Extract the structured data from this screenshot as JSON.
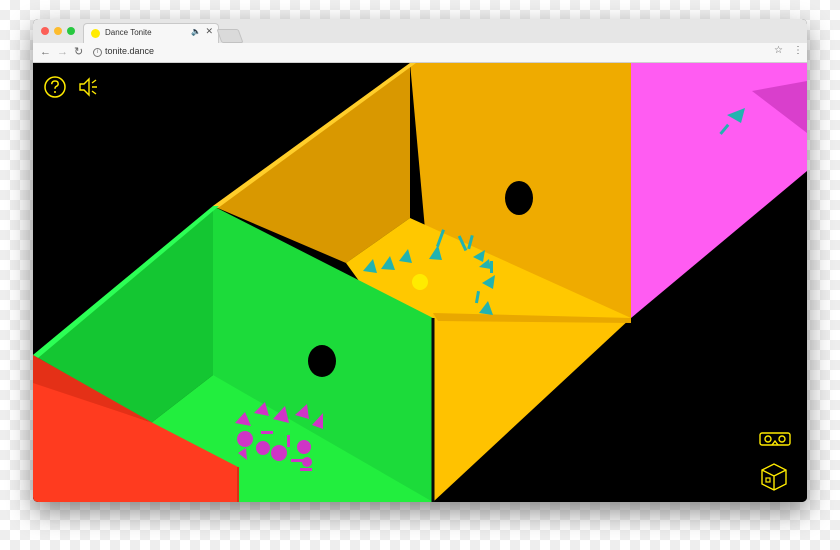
{
  "browser": {
    "tab_title": "Dance Tonite",
    "url": "tonite.dance",
    "info_glyph": "i",
    "tab_audio_glyph": "🔈",
    "tab_close_glyph": "✕",
    "back_glyph": "←",
    "forward_glyph": "→",
    "reload_glyph": "↻",
    "star_glyph": "☆",
    "menu_glyph": "⋮"
  },
  "icons": {
    "help": "help-icon",
    "audio": "audio-icon",
    "vr": "vr-headset-icon",
    "room": "room-cube-icon"
  },
  "colors": {
    "accent": "#ffeb00",
    "close_dot": "#fc5f57",
    "minimize_dot": "#fdbc2e",
    "maximize_dot": "#28c840",
    "room_red": "#ff3b1f",
    "room_green": "#1fe23f",
    "room_orange": "#f0ad00",
    "room_yellow": "#ffc800",
    "room_magenta": "#ff5cf2",
    "dancer_cyan": "#22b3b0",
    "dancer_magenta": "#cf35c6"
  }
}
